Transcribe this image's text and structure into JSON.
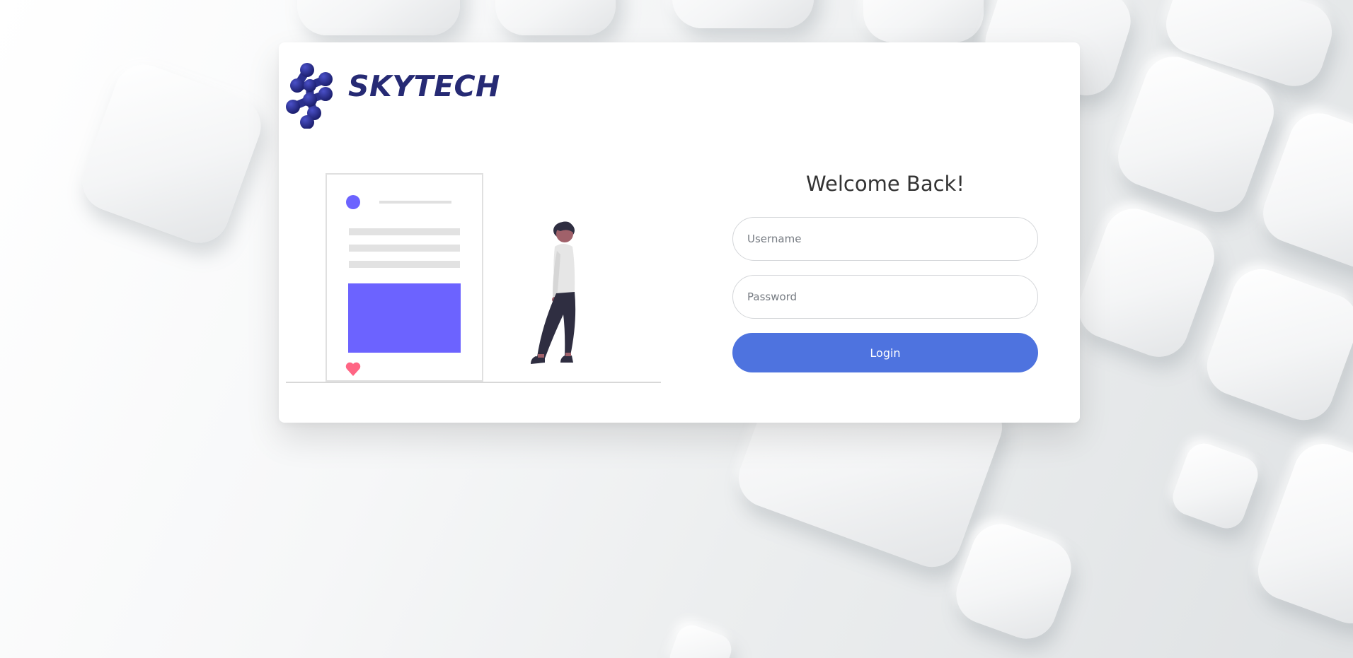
{
  "brand": {
    "name": "SKYTECH",
    "text_color": "#262a74"
  },
  "login": {
    "title": "Welcome Back!",
    "username_placeholder": "Username",
    "password_placeholder": "Password",
    "button_label": "Login"
  },
  "colors": {
    "accent": "#4e73df",
    "illustration_purple": "#6c63ff",
    "heart": "#ff6584"
  },
  "illustration": {
    "icon": "person-with-post-illustration"
  }
}
